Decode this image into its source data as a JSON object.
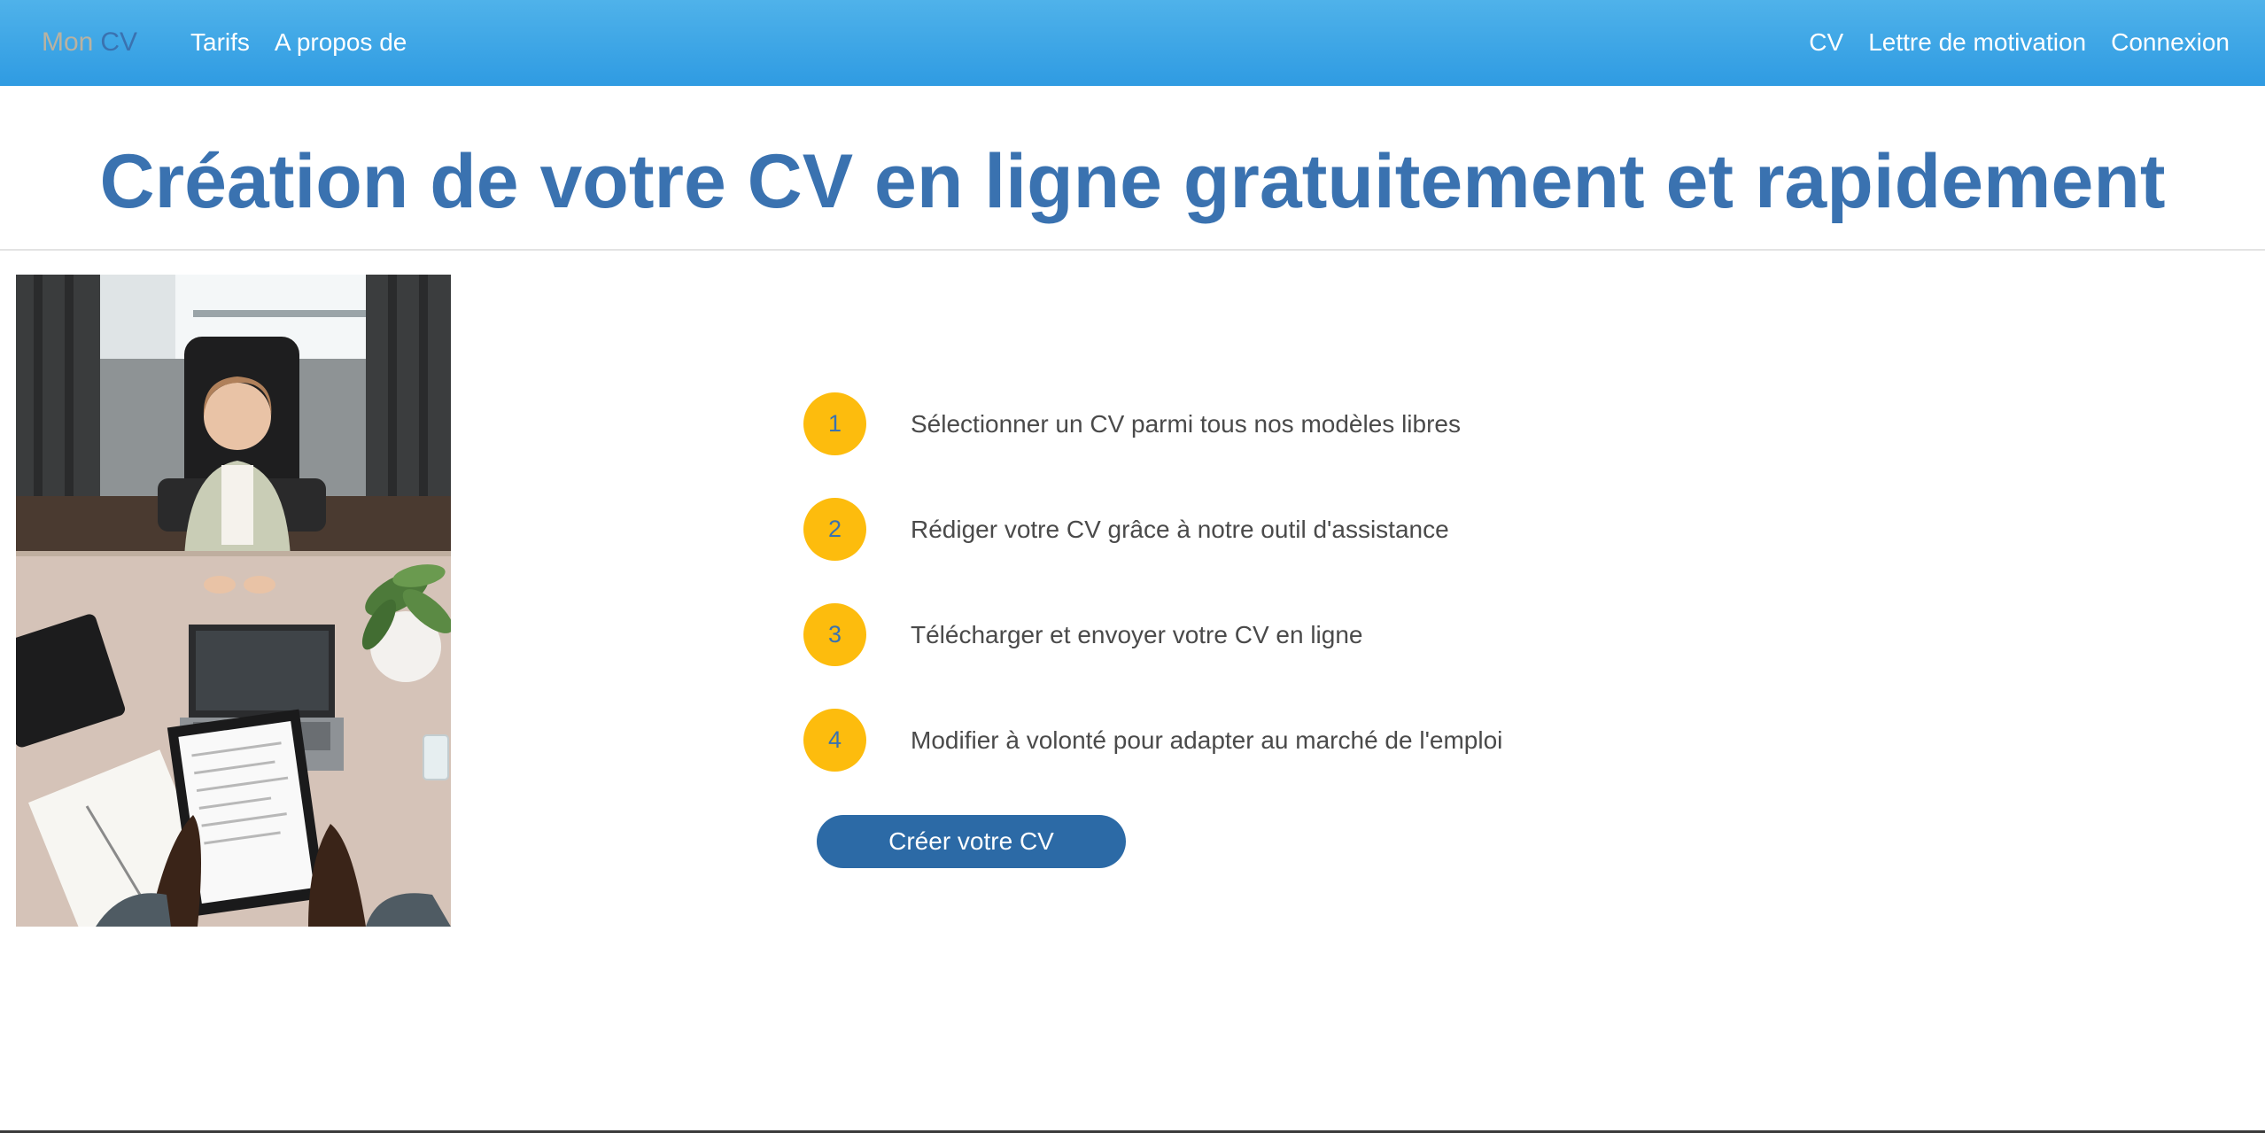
{
  "brand": {
    "part1": "Mon",
    "part2": "CV"
  },
  "nav": {
    "left": [
      "Tarifs",
      "A propos de"
    ],
    "right": [
      "CV",
      "Lettre de motivation",
      "Connexion"
    ]
  },
  "hero": {
    "title": "Création de votre CV en ligne gratuitement et rapidement"
  },
  "steps": [
    {
      "number": "1",
      "text": "Sélectionner un CV parmi tous nos modèles libres"
    },
    {
      "number": "2",
      "text": "Rédiger votre CV grâce à notre outil d'assistance"
    },
    {
      "number": "3",
      "text": "Télécharger et envoyer votre CV en ligne"
    },
    {
      "number": "4",
      "text": "Modifier à volonté pour adapter au marché de l'emploi"
    }
  ],
  "cta": {
    "label": "Créer votre CV"
  },
  "colors": {
    "navbar": "#3aa3e6",
    "brand_mon": "#b9b2a1",
    "brand_cv": "#3a72b0",
    "title": "#3a72b0",
    "step_circle": "#fdbc0d",
    "button": "#2c6aa6"
  }
}
